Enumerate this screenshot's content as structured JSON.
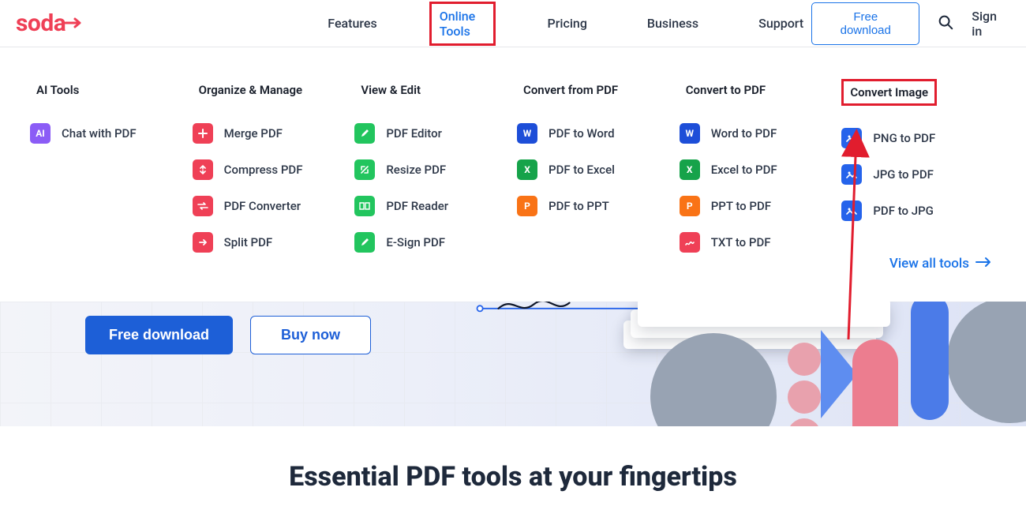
{
  "brand": {
    "name": "soda"
  },
  "nav": {
    "features": "Features",
    "online_tools": "Online Tools",
    "pricing": "Pricing",
    "business": "Business",
    "support": "Support"
  },
  "header": {
    "free_download": "Free download",
    "sign_in": "Sign in"
  },
  "menu": {
    "ai_tools": {
      "heading": "AI Tools",
      "items": [
        "Chat with PDF"
      ]
    },
    "organize": {
      "heading": "Organize & Manage",
      "items": [
        "Merge PDF",
        "Compress PDF",
        "PDF Converter",
        "Split PDF"
      ]
    },
    "view_edit": {
      "heading": "View & Edit",
      "items": [
        "PDF Editor",
        "Resize PDF",
        "PDF Reader",
        "E-Sign PDF"
      ]
    },
    "convert_from": {
      "heading": "Convert from PDF",
      "items": [
        "PDF to Word",
        "PDF to Excel",
        "PDF to PPT"
      ]
    },
    "convert_to": {
      "heading": "Convert to PDF",
      "items": [
        "Word to PDF",
        "Excel to PDF",
        "PPT to PDF",
        "TXT to PDF"
      ]
    },
    "convert_image": {
      "heading": "Convert Image",
      "items": [
        "PNG to PDF",
        "JPG to PDF",
        "PDF to JPG"
      ]
    },
    "view_all": "View all tools"
  },
  "hero": {
    "free_download": "Free download",
    "buy_now": "Buy now"
  },
  "headline": "Essential PDF tools at your fingertips"
}
